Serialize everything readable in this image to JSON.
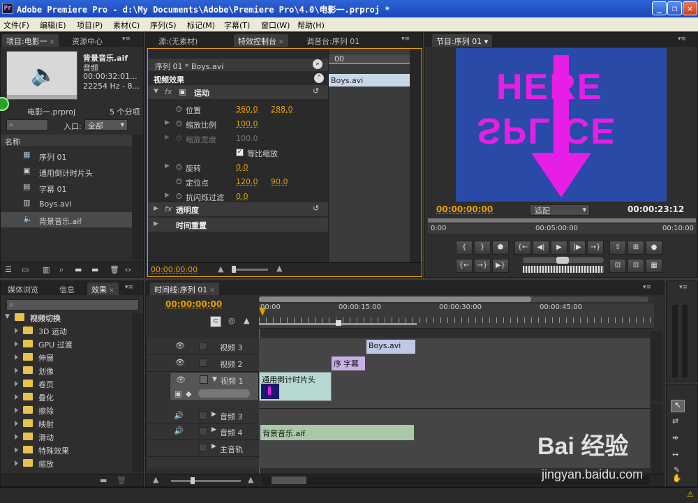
{
  "title": {
    "text": "Adobe Premiere Pro - d:\\My Documents\\Adobe\\Premiere Pro\\4.0\\电影一.prproj *",
    "app_icon": "Pr"
  },
  "menu": [
    "文件(F)",
    "编辑(E)",
    "项目(P)",
    "素材(C)",
    "序列(S)",
    "标记(M)",
    "字幕(T)",
    "窗口(W)",
    "帮助(H)"
  ],
  "project": {
    "tabs": [
      "项目:电影一",
      "资源中心"
    ],
    "preview": {
      "name": "背景音乐.aif",
      "type": "音频",
      "duration": "00:00:32:01...",
      "rate": "22254 Hz - 8..."
    },
    "project_name": "电影一.prproj",
    "item_count": "5 个分项",
    "in_label": "入口:",
    "in_value": "全部",
    "name_header": "名称",
    "items": [
      {
        "label": "序列 01",
        "icon": "sequence-icon"
      },
      {
        "label": "通用倒计时片头",
        "icon": "countdown-icon"
      },
      {
        "label": "字幕 01",
        "icon": "title-icon"
      },
      {
        "label": "Boys.avi",
        "icon": "film-icon"
      },
      {
        "label": "背景音乐.aif",
        "icon": "audio-icon"
      }
    ]
  },
  "effect_controls": {
    "tabs": [
      "源:(无素材)",
      "特效控制台",
      "调音台:序列 01"
    ],
    "header": "序列 01 * Boys.avi",
    "mini_time": "00",
    "mini_clip": "Boys.avi",
    "section": "视频效果",
    "motion": "运动",
    "position_label": "位置",
    "position_x": "360.0",
    "position_y": "288.0",
    "scale_label": "缩放比例",
    "scale": "100.0",
    "scale_w_label": "缩放宽度",
    "scale_w": "100.0",
    "uniform_label": "等比缩放",
    "rotation_label": "旋转",
    "rotation": "0.0",
    "anchor_label": "定位点",
    "anchor_x": "120.0",
    "anchor_y": "90.0",
    "antiflicker_label": "抗闪烁过滤",
    "antiflicker": "0.0",
    "opacity": "透明度",
    "time_remap": "时间重置",
    "timecode": "00:00:00:00"
  },
  "program": {
    "tab": "节目:序列 01",
    "video_text_top": "HERE",
    "video_text_bottom": "SPLICE",
    "timecode": "00:00:00:00",
    "fit": "适配",
    "duration": "00:00:23:12",
    "ruler": [
      "0:00",
      "00:05:00:00",
      "00:10:00"
    ]
  },
  "effects": {
    "tabs": [
      "媒体浏览",
      "信息",
      "效果"
    ],
    "root": "视频切换",
    "folders": [
      "3D 运动",
      "GPU 过渡",
      "伸展",
      "划像",
      "卷页",
      "叠化",
      "擦除",
      "映射",
      "滑动",
      "特殊效果",
      "缩放"
    ]
  },
  "timeline": {
    "tab": "时间线:序列 01",
    "timecode": "00:00:00:00",
    "ruler": [
      "00:00",
      "00:00:15:00",
      "00:00:30:00",
      "00:00:45:00"
    ],
    "tracks": {
      "v3": "视频 3",
      "v2": "视频 2",
      "v1": "视频 1",
      "a3": "音频 3",
      "a4": "音频 4",
      "master": "主音轨"
    },
    "clips": {
      "boys": "Boys.avi",
      "title_a": "序",
      "title_b": "字幕",
      "countdown": "通用倒计时片头",
      "audio": "背景音乐.aif"
    }
  },
  "watermark": {
    "brand": "Bai 经验",
    "url": "jingyan.baidu.com"
  }
}
